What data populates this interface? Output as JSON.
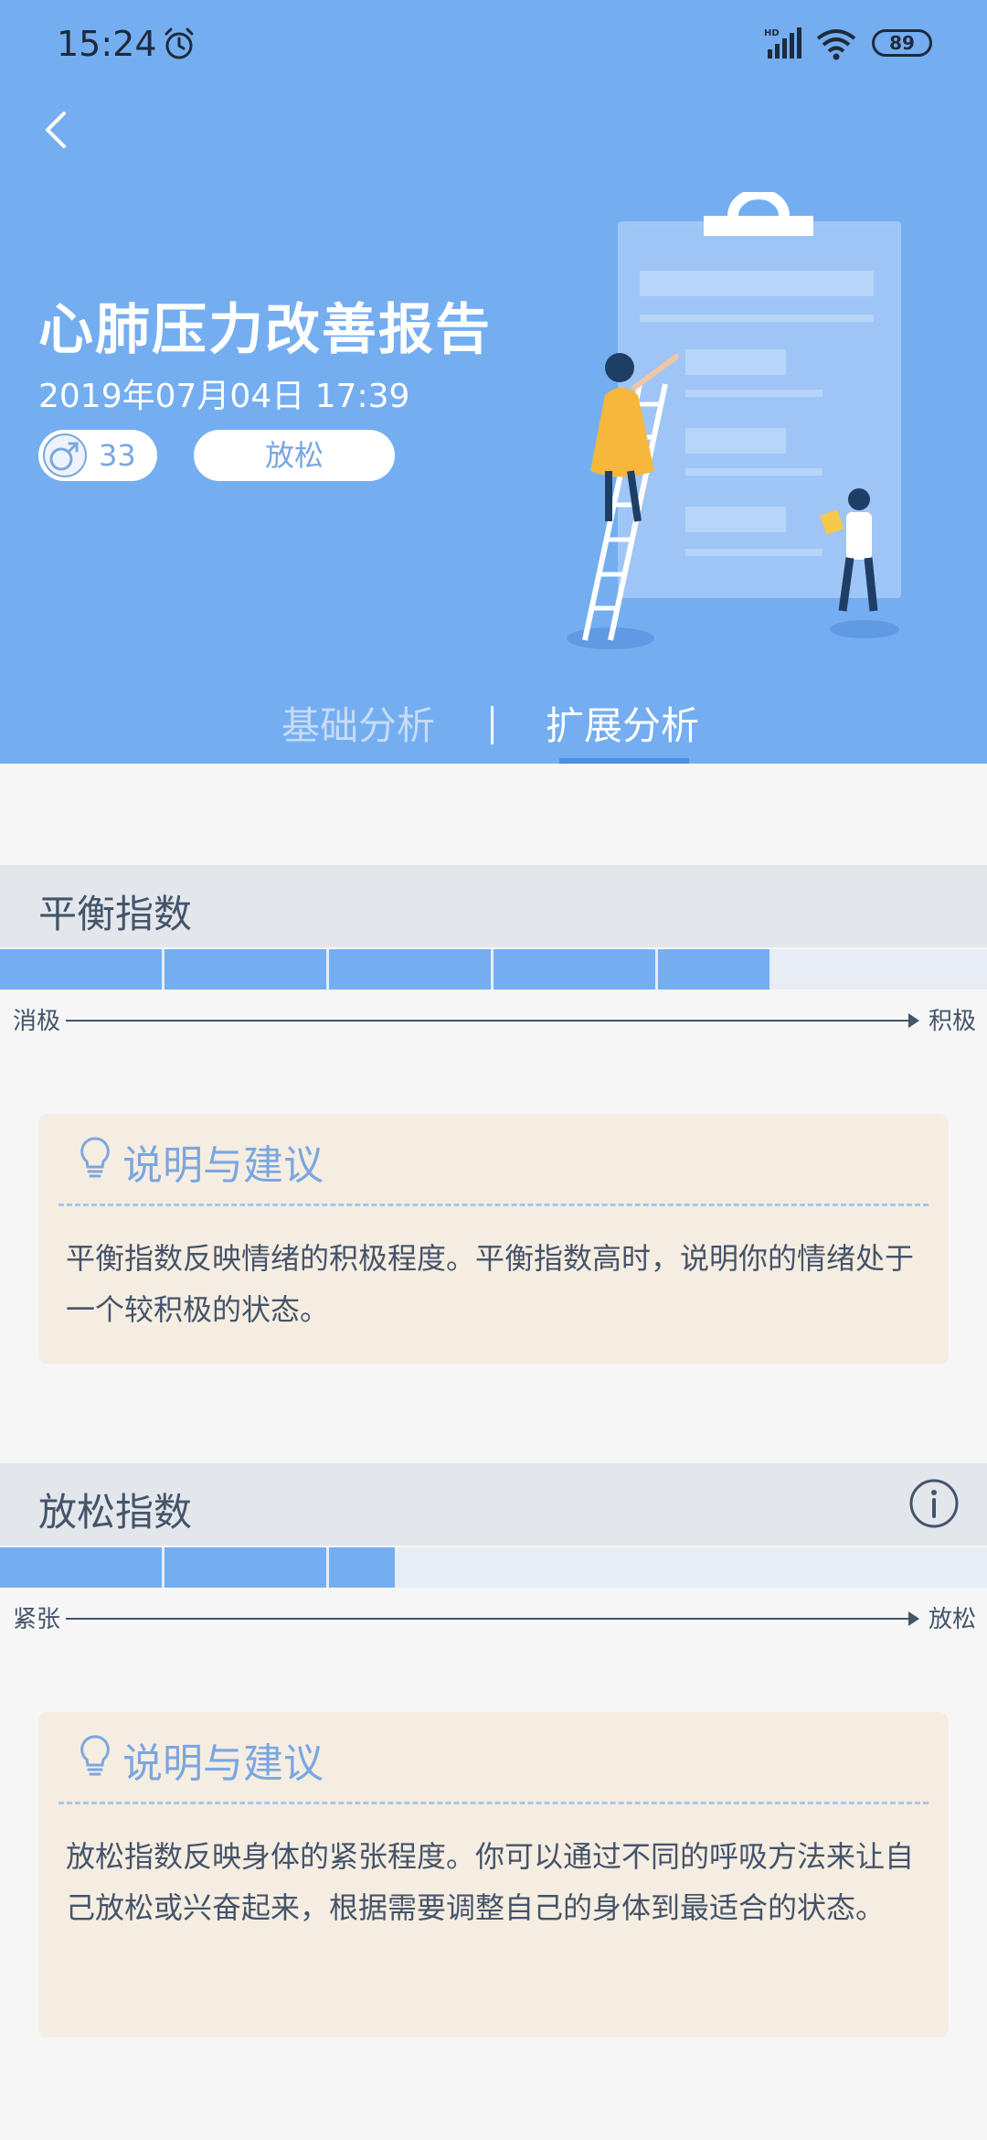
{
  "status_bar": {
    "time": "15:24",
    "battery": "89",
    "network_badge": "HD"
  },
  "header": {
    "title": "心肺压力改善报告",
    "date": "2019年07月04日 17:39",
    "age": "33",
    "state_label": "放松"
  },
  "tabs": [
    {
      "label": "基础分析",
      "active": false
    },
    {
      "label": "扩展分析",
      "active": true
    }
  ],
  "sections": [
    {
      "title": "平衡指数",
      "bar_level_fraction": 0.78,
      "bar_segment_count": 5,
      "axis_left": "消极",
      "axis_right": "积极",
      "advice_title": "说明与建议",
      "advice_text": "平衡指数反映情绪的积极程度。平衡指数高时，说明你的情绪处于一个较积极的状态。"
    },
    {
      "title": "放松指数",
      "bar_level_fraction": 0.4,
      "bar_segment_count": 3,
      "axis_left": "紧张",
      "axis_right": "放松",
      "advice_title": "说明与建议",
      "advice_text": "放松指数反映身体的紧张程度。你可以通过不同的呼吸方法来让自己放松或兴奋起来，根据需要调整自己的身体到最适合的状态。"
    }
  ],
  "colors": {
    "header_bg": "#74aef1",
    "bar_fill": "#74aef1",
    "bar_track": "#e8edf5",
    "advice_bg": "#f6ede2",
    "advice_title": "#7aa7e0",
    "text": "#44546a"
  },
  "icons": [
    "alarm-icon",
    "signal-icon",
    "wifi-icon",
    "back-icon",
    "male-icon",
    "info-icon",
    "lightbulb-icon"
  ]
}
